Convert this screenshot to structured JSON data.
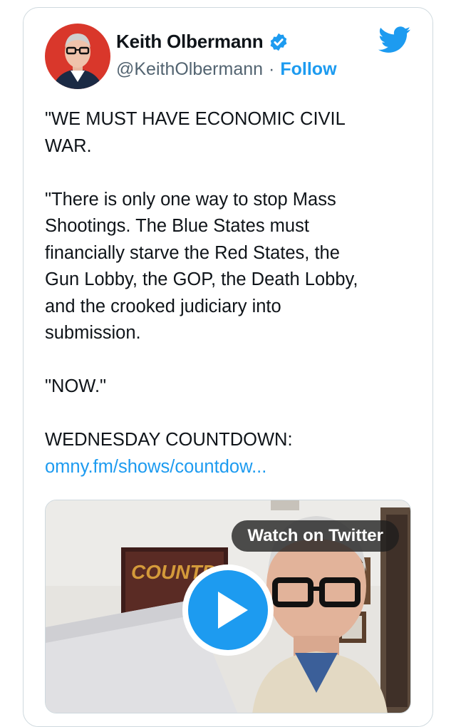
{
  "author": {
    "display_name": "Keith Olbermann",
    "handle": "@KeithOlbermann",
    "separator": "·",
    "follow_label": "Follow",
    "verified": true
  },
  "tweet": {
    "body": "\"WE MUST HAVE ECONOMIC CIVIL\nWAR.\n\n\"There is only one way to stop Mass\nShootings. The Blue States must\nfinancially starve the Red States, the\nGun Lobby, the GOP, the Death Lobby,\nand the crooked judiciary into\nsubmission.\n\n\"NOW.\"\n\nWEDNESDAY COUNTDOWN:",
    "link_text": "omny.fm/shows/countdow..."
  },
  "media": {
    "watch_label": "Watch on Twitter",
    "poster_text": "COUNTD"
  },
  "colors": {
    "accent": "#1d9bf0",
    "text": "#0f1419",
    "secondary": "#536471",
    "border": "#cfd9de"
  }
}
